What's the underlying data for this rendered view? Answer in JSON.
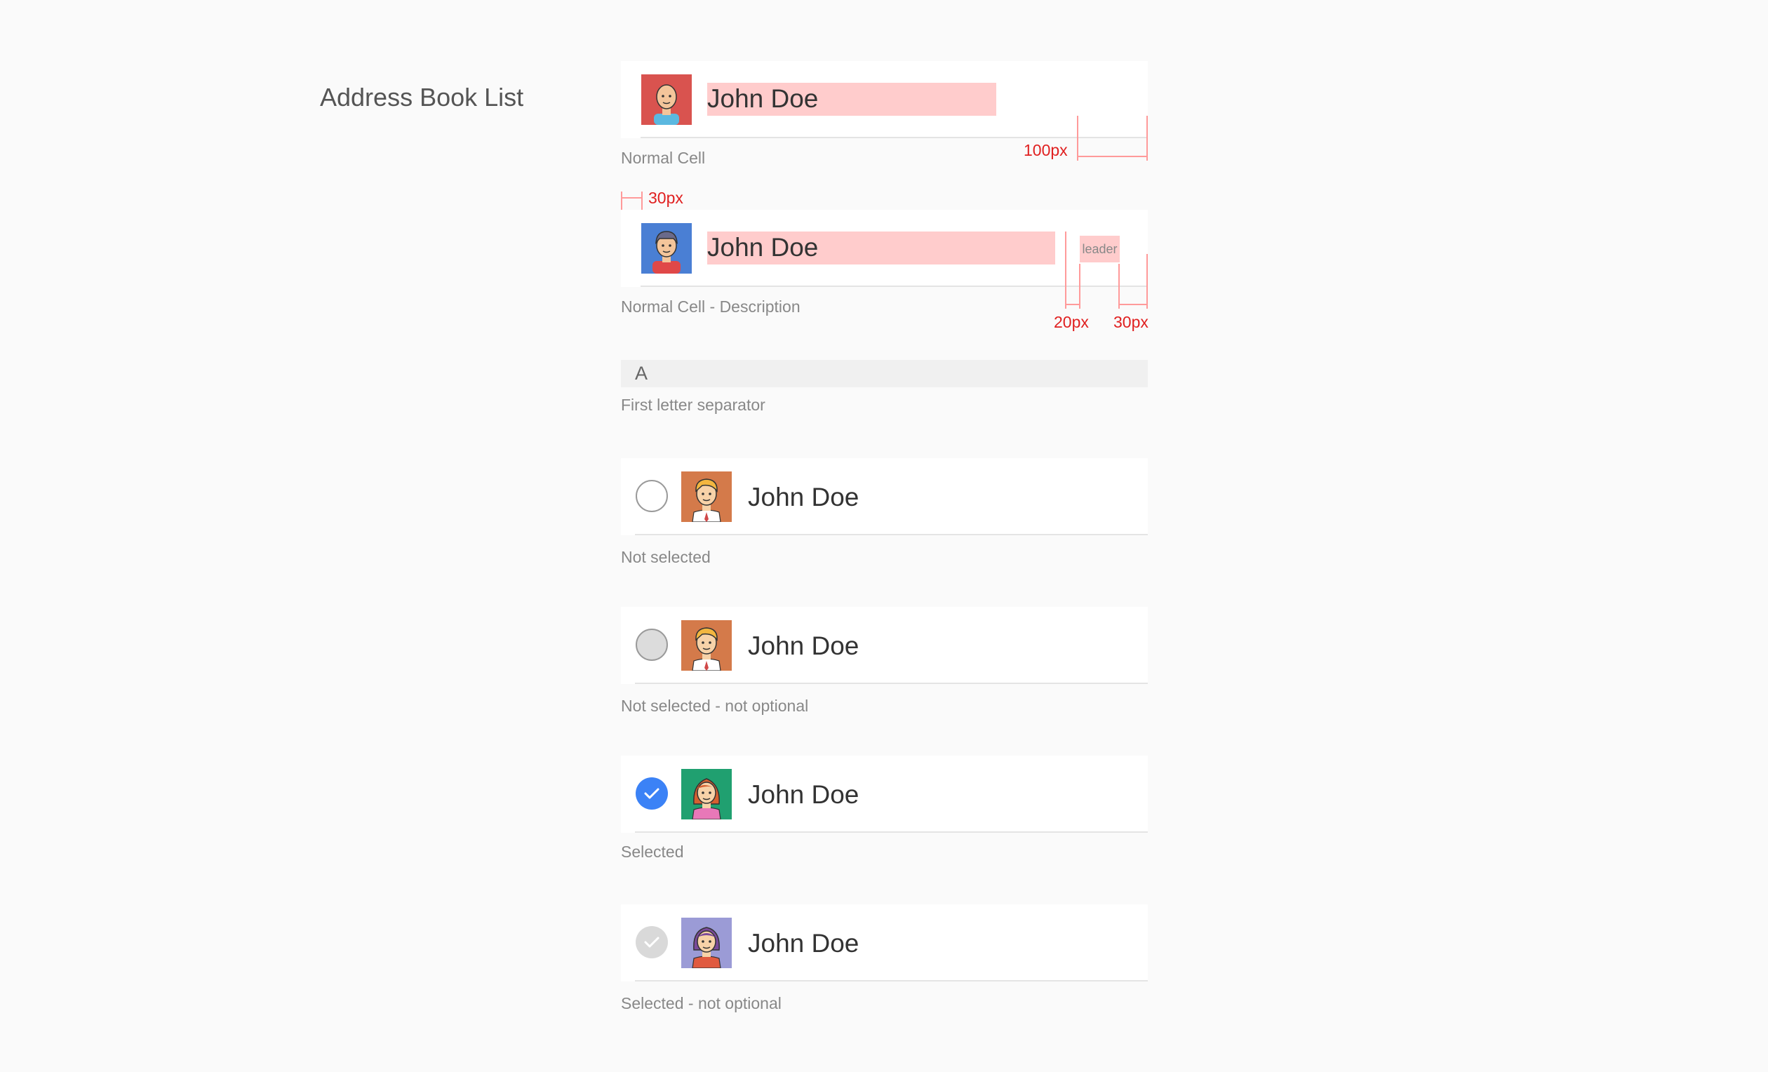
{
  "title": "Address Book List",
  "cells": {
    "normal": {
      "name": "John Doe",
      "caption": "Normal Cell",
      "avatar": "man-avatar-icon"
    },
    "description": {
      "name": "John Doe",
      "tag": "leader",
      "caption": "Normal Cell - Description",
      "avatar": "man-avatar-icon"
    },
    "separator": {
      "letter": "A",
      "caption": "First letter separator"
    },
    "not_selected": {
      "name": "John Doe",
      "caption": "Not selected",
      "state": "unchecked"
    },
    "not_selected_disabled": {
      "name": "John Doe",
      "caption": "Not selected - not optional",
      "state": "unchecked-disabled"
    },
    "selected": {
      "name": "John Doe",
      "caption": "Selected",
      "state": "checked"
    },
    "selected_disabled": {
      "name": "John Doe",
      "caption": "Selected - not optional",
      "state": "checked-disabled"
    }
  },
  "measurements": {
    "right_padding": "100px",
    "left_padding": "30px",
    "tag_gap": "20px",
    "tag_right": "30px"
  },
  "colors": {
    "background": "#fafafa",
    "highlight": "#ffcccc",
    "measure": "#e02020",
    "checked": "#3b82f6",
    "avatar_red": "#d9534f",
    "avatar_blue": "#4a7fd4",
    "avatar_orange": "#e08a50",
    "avatar_green": "#20a070",
    "avatar_purple": "#9b9bd6"
  }
}
